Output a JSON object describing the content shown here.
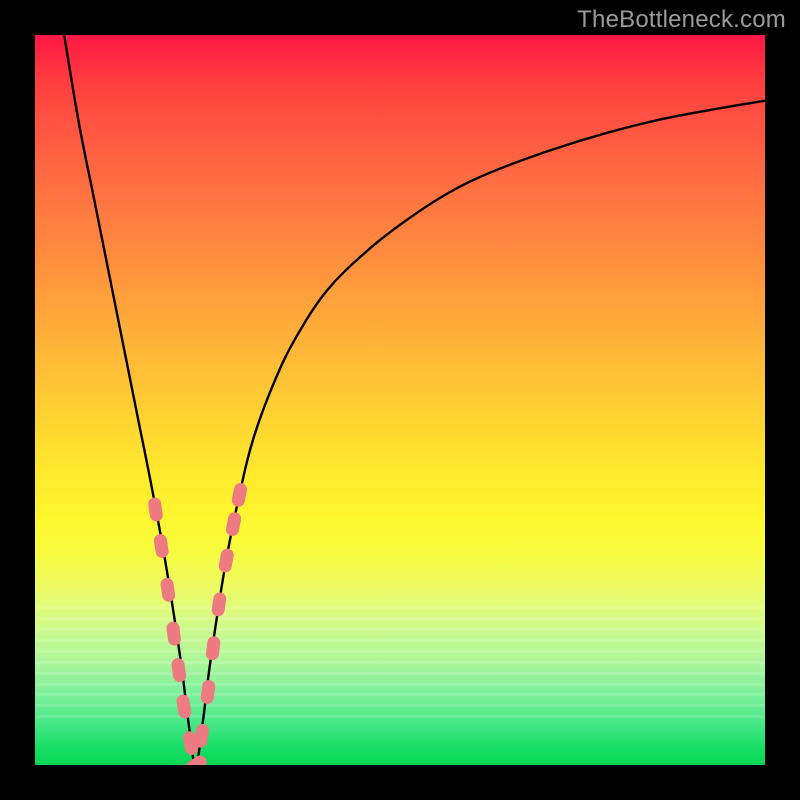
{
  "watermark": "TheBottleneck.com",
  "colors": {
    "frame": "#000000",
    "curve": "#000000",
    "marker": "#ee7b82",
    "gradient_top": "#ff1744",
    "gradient_bottom": "#06d653"
  },
  "chart_data": {
    "type": "line",
    "title": "",
    "xlabel": "",
    "ylabel": "",
    "xlim": [
      0,
      100
    ],
    "ylim": [
      0,
      100
    ],
    "notch_x": 22,
    "series": [
      {
        "name": "bottleneck-curve",
        "x": [
          4,
          6,
          8,
          10,
          12,
          14,
          16,
          18,
          20,
          21,
          22,
          23,
          24,
          26,
          28,
          30,
          33,
          36,
          40,
          45,
          50,
          56,
          62,
          70,
          78,
          86,
          94,
          100
        ],
        "values": [
          100,
          88,
          78,
          68,
          58,
          48,
          38,
          27,
          14,
          6,
          0,
          6,
          14,
          27,
          37,
          45,
          53,
          59,
          65,
          70,
          74,
          78,
          81,
          84,
          86.5,
          88.5,
          90,
          91
        ]
      }
    ],
    "markers": {
      "name": "highlighted-points",
      "x": [
        16.5,
        17.3,
        18.2,
        19.0,
        19.7,
        20.4,
        21.3,
        22.0,
        22.8,
        23.7,
        24.4,
        25.2,
        26.2,
        27.2,
        28.0
      ],
      "values": [
        35,
        30,
        24,
        18,
        13,
        8,
        3,
        0,
        4,
        10,
        16,
        22,
        28,
        33,
        37
      ]
    },
    "bands_y_pct": [
      78.2,
      79.7,
      81.2,
      82.7,
      84.2,
      85.7,
      87.2,
      88.7,
      90.2,
      91.7,
      93.2
    ]
  }
}
